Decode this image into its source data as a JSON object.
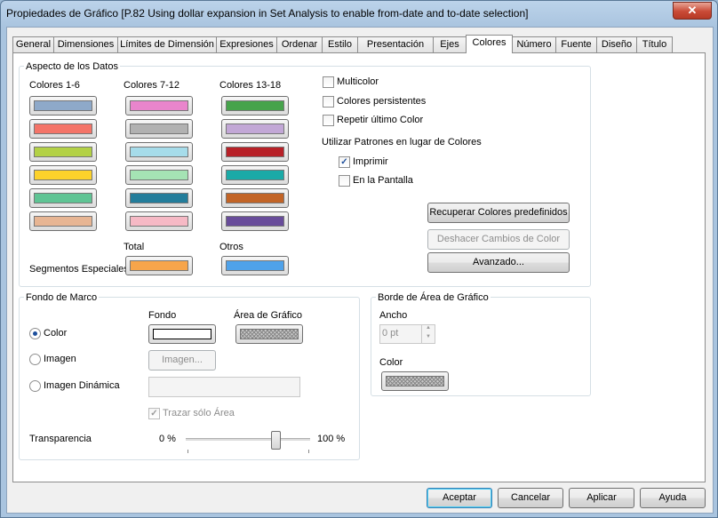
{
  "window": {
    "title": "Propiedades de Gráfico [P.82 Using dollar expansion in Set Analysis to enable from-date and to-date selection]",
    "close_glyph": "✕"
  },
  "tabs": [
    {
      "label": "General"
    },
    {
      "label": "Dimensiones"
    },
    {
      "label": "Límites de Dimensión"
    },
    {
      "label": "Expresiones"
    },
    {
      "label": "Ordenar"
    },
    {
      "label": "Estilo"
    },
    {
      "label": "Presentación"
    },
    {
      "label": "Ejes"
    },
    {
      "label": "Colores",
      "active": true
    },
    {
      "label": "Número"
    },
    {
      "label": "Fuente"
    },
    {
      "label": "Diseño"
    },
    {
      "label": "Título"
    }
  ],
  "data_appearance": {
    "title": "Aspecto de los Datos",
    "col1_label": "Colores 1-6",
    "col2_label": "Colores 7-12",
    "col3_label": "Colores 13-18",
    "colors": [
      "#8ea9c9",
      "#f47468",
      "#b3d146",
      "#fdd22b",
      "#5fc494",
      "#e7b593",
      "#e985cc",
      "#b1b1b1",
      "#a6dcea",
      "#a5e3b4",
      "#237d9b",
      "#f6b9c5",
      "#46a34b",
      "#c2a7d6",
      "#b72027",
      "#1aaaa7",
      "#c26426",
      "#684c9a"
    ],
    "special_label": "Segmentos Especiales",
    "total_label": "Total",
    "others_label": "Otros",
    "total_color": "#f7a54b",
    "others_color": "#4fa2ea",
    "multicolor": "Multicolor",
    "persistent": "Colores persistentes",
    "repeat_last": "Repetir último Color",
    "patterns_label": "Utilizar Patrones en lugar de Colores",
    "print": "Imprimir",
    "print_checked": "✓",
    "on_screen": "En la Pantalla",
    "restore_btn": "Recuperar Colores predefinidos",
    "undo_btn": "Deshacer Cambios de Color",
    "advanced_btn": "Avanzado..."
  },
  "frame_bg": {
    "title": "Fondo de Marco",
    "fondo_label": "Fondo",
    "area_label": "Área de Gráfico",
    "color_opt": "Color",
    "image_opt": "Imagen",
    "dynamic_opt": "Imagen Dinámica",
    "image_btn": "Imagen...",
    "plot_area_only": "Trazar sólo Área",
    "plot_area_only_checked": "✓",
    "transparency_label": "Transparencia",
    "t_min": "0 %",
    "t_max": "100 %",
    "transparency_value": 0.72
  },
  "plot_border": {
    "title": "Borde de Área de Gráfico",
    "width_label": "Ancho",
    "width_value": "0 pt",
    "color_label": "Color"
  },
  "footer": {
    "accept": "Aceptar",
    "cancel": "Cancelar",
    "apply": "Aplicar",
    "help": "Ayuda"
  }
}
